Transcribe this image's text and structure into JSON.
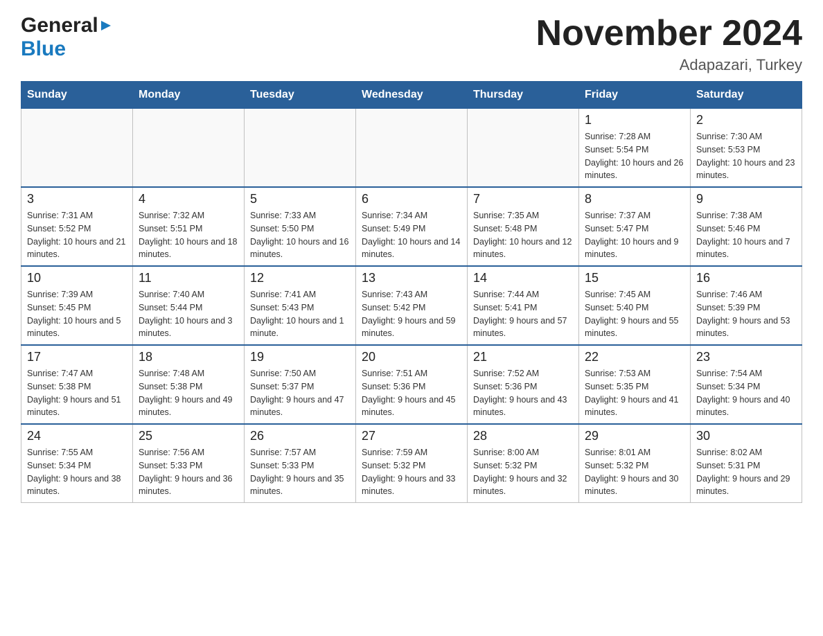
{
  "logo": {
    "general": "General",
    "blue": "Blue",
    "triangle": "▶"
  },
  "title": "November 2024",
  "location": "Adapazari, Turkey",
  "days_header": [
    "Sunday",
    "Monday",
    "Tuesday",
    "Wednesday",
    "Thursday",
    "Friday",
    "Saturday"
  ],
  "weeks": [
    [
      {
        "day": "",
        "info": ""
      },
      {
        "day": "",
        "info": ""
      },
      {
        "day": "",
        "info": ""
      },
      {
        "day": "",
        "info": ""
      },
      {
        "day": "",
        "info": ""
      },
      {
        "day": "1",
        "info": "Sunrise: 7:28 AM\nSunset: 5:54 PM\nDaylight: 10 hours and 26 minutes."
      },
      {
        "day": "2",
        "info": "Sunrise: 7:30 AM\nSunset: 5:53 PM\nDaylight: 10 hours and 23 minutes."
      }
    ],
    [
      {
        "day": "3",
        "info": "Sunrise: 7:31 AM\nSunset: 5:52 PM\nDaylight: 10 hours and 21 minutes."
      },
      {
        "day": "4",
        "info": "Sunrise: 7:32 AM\nSunset: 5:51 PM\nDaylight: 10 hours and 18 minutes."
      },
      {
        "day": "5",
        "info": "Sunrise: 7:33 AM\nSunset: 5:50 PM\nDaylight: 10 hours and 16 minutes."
      },
      {
        "day": "6",
        "info": "Sunrise: 7:34 AM\nSunset: 5:49 PM\nDaylight: 10 hours and 14 minutes."
      },
      {
        "day": "7",
        "info": "Sunrise: 7:35 AM\nSunset: 5:48 PM\nDaylight: 10 hours and 12 minutes."
      },
      {
        "day": "8",
        "info": "Sunrise: 7:37 AM\nSunset: 5:47 PM\nDaylight: 10 hours and 9 minutes."
      },
      {
        "day": "9",
        "info": "Sunrise: 7:38 AM\nSunset: 5:46 PM\nDaylight: 10 hours and 7 minutes."
      }
    ],
    [
      {
        "day": "10",
        "info": "Sunrise: 7:39 AM\nSunset: 5:45 PM\nDaylight: 10 hours and 5 minutes."
      },
      {
        "day": "11",
        "info": "Sunrise: 7:40 AM\nSunset: 5:44 PM\nDaylight: 10 hours and 3 minutes."
      },
      {
        "day": "12",
        "info": "Sunrise: 7:41 AM\nSunset: 5:43 PM\nDaylight: 10 hours and 1 minute."
      },
      {
        "day": "13",
        "info": "Sunrise: 7:43 AM\nSunset: 5:42 PM\nDaylight: 9 hours and 59 minutes."
      },
      {
        "day": "14",
        "info": "Sunrise: 7:44 AM\nSunset: 5:41 PM\nDaylight: 9 hours and 57 minutes."
      },
      {
        "day": "15",
        "info": "Sunrise: 7:45 AM\nSunset: 5:40 PM\nDaylight: 9 hours and 55 minutes."
      },
      {
        "day": "16",
        "info": "Sunrise: 7:46 AM\nSunset: 5:39 PM\nDaylight: 9 hours and 53 minutes."
      }
    ],
    [
      {
        "day": "17",
        "info": "Sunrise: 7:47 AM\nSunset: 5:38 PM\nDaylight: 9 hours and 51 minutes."
      },
      {
        "day": "18",
        "info": "Sunrise: 7:48 AM\nSunset: 5:38 PM\nDaylight: 9 hours and 49 minutes."
      },
      {
        "day": "19",
        "info": "Sunrise: 7:50 AM\nSunset: 5:37 PM\nDaylight: 9 hours and 47 minutes."
      },
      {
        "day": "20",
        "info": "Sunrise: 7:51 AM\nSunset: 5:36 PM\nDaylight: 9 hours and 45 minutes."
      },
      {
        "day": "21",
        "info": "Sunrise: 7:52 AM\nSunset: 5:36 PM\nDaylight: 9 hours and 43 minutes."
      },
      {
        "day": "22",
        "info": "Sunrise: 7:53 AM\nSunset: 5:35 PM\nDaylight: 9 hours and 41 minutes."
      },
      {
        "day": "23",
        "info": "Sunrise: 7:54 AM\nSunset: 5:34 PM\nDaylight: 9 hours and 40 minutes."
      }
    ],
    [
      {
        "day": "24",
        "info": "Sunrise: 7:55 AM\nSunset: 5:34 PM\nDaylight: 9 hours and 38 minutes."
      },
      {
        "day": "25",
        "info": "Sunrise: 7:56 AM\nSunset: 5:33 PM\nDaylight: 9 hours and 36 minutes."
      },
      {
        "day": "26",
        "info": "Sunrise: 7:57 AM\nSunset: 5:33 PM\nDaylight: 9 hours and 35 minutes."
      },
      {
        "day": "27",
        "info": "Sunrise: 7:59 AM\nSunset: 5:32 PM\nDaylight: 9 hours and 33 minutes."
      },
      {
        "day": "28",
        "info": "Sunrise: 8:00 AM\nSunset: 5:32 PM\nDaylight: 9 hours and 32 minutes."
      },
      {
        "day": "29",
        "info": "Sunrise: 8:01 AM\nSunset: 5:32 PM\nDaylight: 9 hours and 30 minutes."
      },
      {
        "day": "30",
        "info": "Sunrise: 8:02 AM\nSunset: 5:31 PM\nDaylight: 9 hours and 29 minutes."
      }
    ]
  ]
}
